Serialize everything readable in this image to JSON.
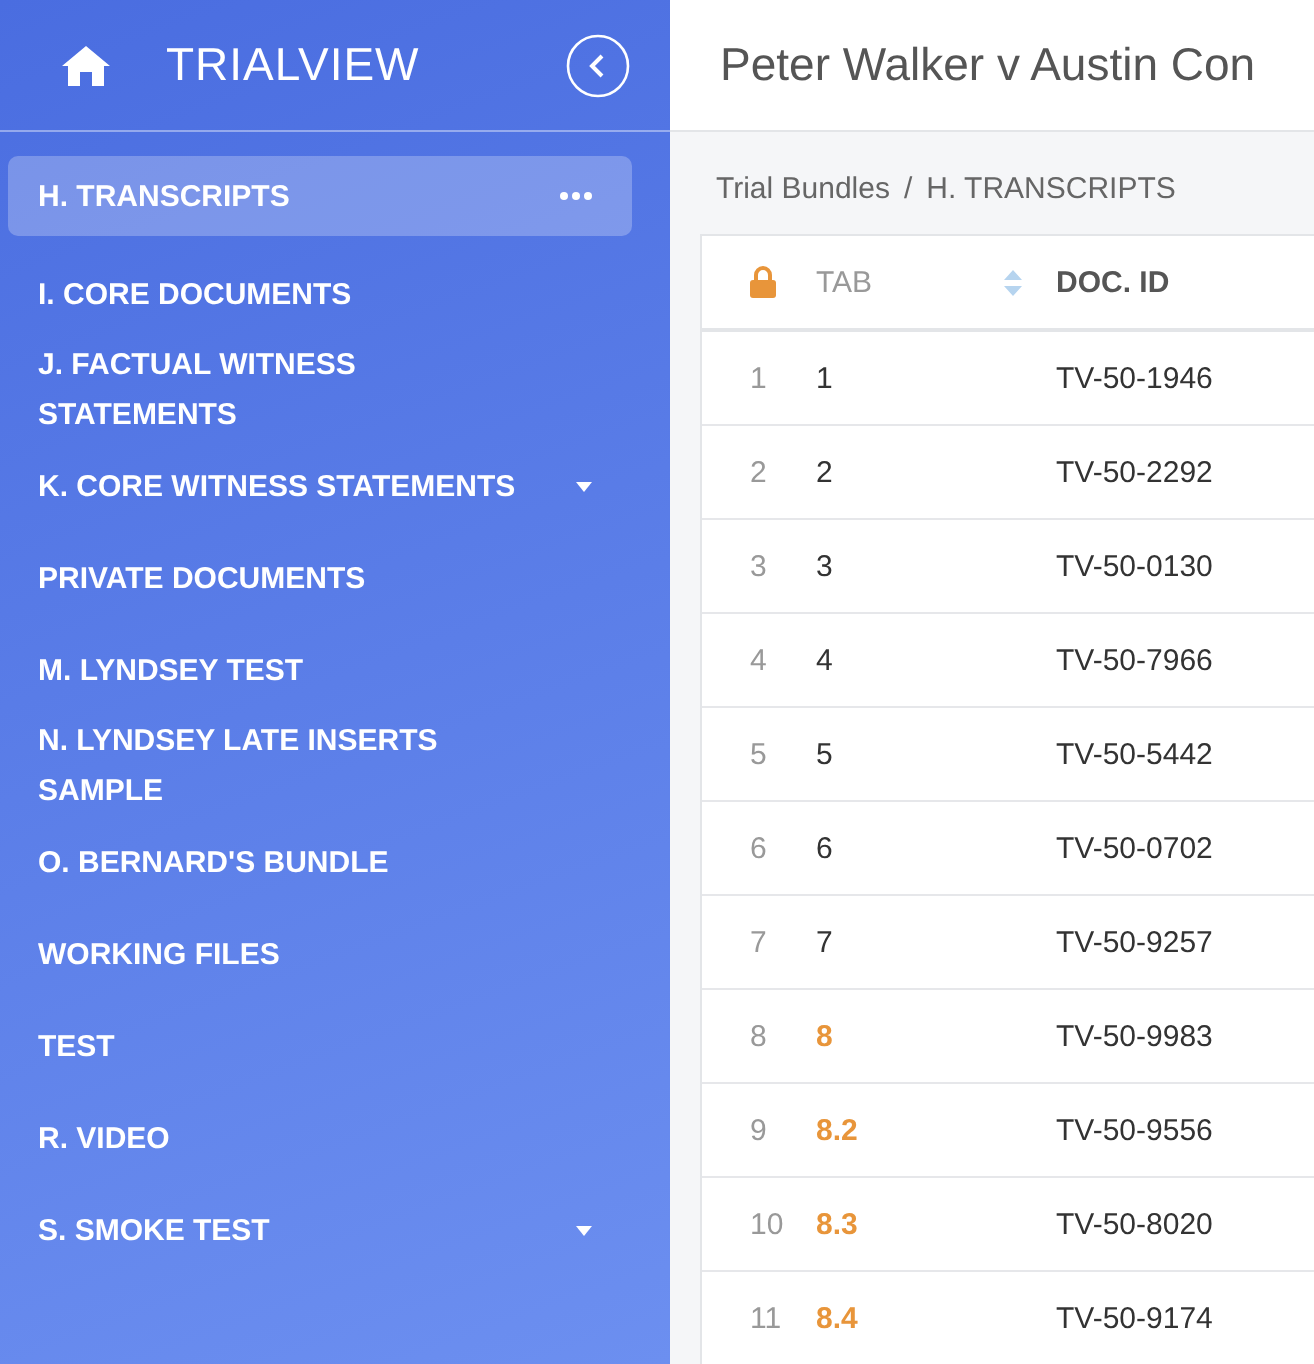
{
  "sidebar": {
    "brand": "TRIALVIEW",
    "items": [
      {
        "label": "H. TRANSCRIPTS",
        "selected": true,
        "more_menu": true,
        "expandable": false
      },
      {
        "label": "I. CORE DOCUMENTS",
        "selected": false,
        "more_menu": false,
        "expandable": false
      },
      {
        "label": "J. FACTUAL WITNESS STATEMENTS",
        "selected": false,
        "more_menu": false,
        "expandable": false
      },
      {
        "label": "K. CORE WITNESS STATEMENTS",
        "selected": false,
        "more_menu": false,
        "expandable": true
      },
      {
        "label": "PRIVATE DOCUMENTS",
        "selected": false,
        "more_menu": false,
        "expandable": false
      },
      {
        "label": "M. LYNDSEY TEST",
        "selected": false,
        "more_menu": false,
        "expandable": false
      },
      {
        "label": "N. LYNDSEY LATE INSERTS SAMPLE",
        "selected": false,
        "more_menu": false,
        "expandable": false
      },
      {
        "label": "O. BERNARD'S BUNDLE",
        "selected": false,
        "more_menu": false,
        "expandable": false
      },
      {
        "label": "WORKING FILES",
        "selected": false,
        "more_menu": false,
        "expandable": false
      },
      {
        "label": "TEST",
        "selected": false,
        "more_menu": false,
        "expandable": false
      },
      {
        "label": "R. VIDEO",
        "selected": false,
        "more_menu": false,
        "expandable": false
      },
      {
        "label": "S. SMOKE TEST",
        "selected": false,
        "more_menu": false,
        "expandable": true
      }
    ]
  },
  "title": "Peter Walker v Austin Con",
  "breadcrumb": [
    "Trial Bundles",
    "/",
    "H. TRANSCRIPTS"
  ],
  "table": {
    "columns": [
      "TAB",
      "DOC. ID"
    ],
    "rows": [
      {
        "n": "1",
        "tab": "1",
        "doc": "TV-50-1946",
        "highlighted": false
      },
      {
        "n": "2",
        "tab": "2",
        "doc": "TV-50-2292",
        "highlighted": false
      },
      {
        "n": "3",
        "tab": "3",
        "doc": "TV-50-0130",
        "highlighted": false
      },
      {
        "n": "4",
        "tab": "4",
        "doc": "TV-50-7966",
        "highlighted": false
      },
      {
        "n": "5",
        "tab": "5",
        "doc": "TV-50-5442",
        "highlighted": false
      },
      {
        "n": "6",
        "tab": "6",
        "doc": "TV-50-0702",
        "highlighted": false
      },
      {
        "n": "7",
        "tab": "7",
        "doc": "TV-50-9257",
        "highlighted": false
      },
      {
        "n": "8",
        "tab": "8",
        "doc": "TV-50-9983",
        "highlighted": true
      },
      {
        "n": "9",
        "tab": "8.2",
        "doc": "TV-50-9556",
        "highlighted": true
      },
      {
        "n": "10",
        "tab": "8.3",
        "doc": "TV-50-8020",
        "highlighted": true
      },
      {
        "n": "11",
        "tab": "8.4",
        "doc": "TV-50-9174",
        "highlighted": true
      }
    ]
  }
}
